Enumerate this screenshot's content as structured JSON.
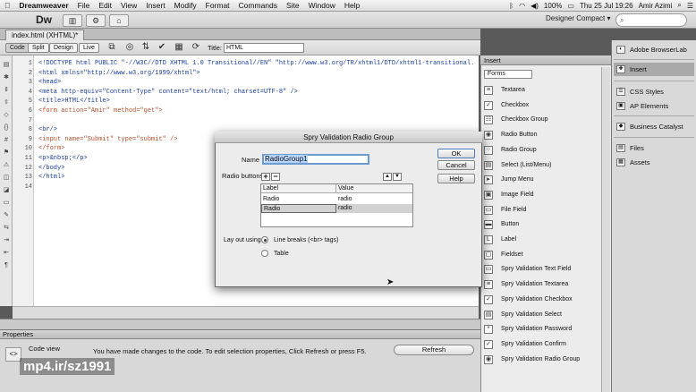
{
  "menubar": {
    "apple": "",
    "app_name": "Dreamweaver",
    "items": [
      "File",
      "Edit",
      "View",
      "Insert",
      "Modify",
      "Format",
      "Commands",
      "Site",
      "Window",
      "Help"
    ],
    "battery": "100%",
    "clock": "Thu 25 Jul 19:26",
    "user": "Amir Azimi"
  },
  "appbar": {
    "logo": "Dw",
    "workspace": "Designer Compact ▾"
  },
  "document": {
    "tab": "index.html (XHTML)*"
  },
  "toolbar": {
    "code": "Code",
    "split": "Split",
    "design": "Design",
    "live": "Live",
    "title_label": "Title:",
    "title_value": "HTML"
  },
  "code": {
    "line_numbers": [
      "1",
      "2",
      "3",
      "4",
      "5",
      "6",
      "7",
      "8",
      "9",
      "10",
      "11",
      "12",
      "13",
      "14"
    ],
    "lines": [
      "<!DOCTYPE html PUBLIC \"-//W3C//DTD XHTML 1.0 Transitional//EN\" \"http://www.w3.org/TR/xhtml1/DTD/xhtml1-transitional.",
      "<html xmlns=\"http://www.w3.org/1999/xhtml\">",
      "<head>",
      "<meta http-equiv=\"Content-Type\" content=\"text/html; charset=UTF-8\" />",
      "<title>HTML</title>",
      "<form action=\"Amir\" method=\"get\">",
      "",
      "<br/>",
      "<input name=\"Submit\" type=\"submit\" />",
      "</form>",
      "<p>&nbsp;</p>",
      "</body>",
      "</html>",
      ""
    ]
  },
  "properties": {
    "title": "Properties",
    "code_view": "Code view",
    "message": "You have made changes to the code. To edit selection properties, Click Refresh or press F5.",
    "refresh": "Refresh"
  },
  "watermark": "mp4.ir/sz1991",
  "insert_panel": {
    "title": "Insert",
    "category": "Forms",
    "items": [
      {
        "label": "Textarea",
        "icon": "textarea-icon",
        "glyph": "≡"
      },
      {
        "label": "Checkbox",
        "icon": "checkbox-icon",
        "glyph": "✓"
      },
      {
        "label": "Checkbox Group",
        "icon": "checkbox-group-icon",
        "glyph": "☷"
      },
      {
        "label": "Radio Button",
        "icon": "radio-button-icon",
        "glyph": "◉"
      },
      {
        "label": "Radio Group",
        "icon": "radio-group-icon",
        "glyph": "⁘"
      },
      {
        "label": "Select (List/Menu)",
        "icon": "select-icon",
        "glyph": "▤"
      },
      {
        "label": "Jump Menu",
        "icon": "jump-menu-icon",
        "glyph": "▸"
      },
      {
        "label": "Image Field",
        "icon": "image-field-icon",
        "glyph": "▣"
      },
      {
        "label": "File Field",
        "icon": "file-field-icon",
        "glyph": "▭"
      },
      {
        "label": "Button",
        "icon": "button-icon",
        "glyph": "▬"
      },
      {
        "label": "Label",
        "icon": "label-icon",
        "glyph": "L"
      },
      {
        "label": "Fieldset",
        "icon": "fieldset-icon",
        "glyph": "▢"
      },
      {
        "label": "Spry Validation Text Field",
        "icon": "spry-text-field-icon",
        "glyph": "▭"
      },
      {
        "label": "Spry Validation Textarea",
        "icon": "spry-textarea-icon",
        "glyph": "≡"
      },
      {
        "label": "Spry Validation Checkbox",
        "icon": "spry-checkbox-icon",
        "glyph": "✓"
      },
      {
        "label": "Spry Validation Select",
        "icon": "spry-select-icon",
        "glyph": "▤"
      },
      {
        "label": "Spry Validation Password",
        "icon": "spry-password-icon",
        "glyph": "*"
      },
      {
        "label": "Spry Validation Confirm",
        "icon": "spry-confirm-icon",
        "glyph": "✓"
      },
      {
        "label": "Spry Validation Radio Group",
        "icon": "spry-radio-group-icon",
        "glyph": "◉"
      }
    ]
  },
  "right_panel": {
    "items": [
      {
        "label": "Adobe BrowserLab",
        "icon": "browserlab-icon",
        "glyph": "◐"
      },
      {
        "label": "Insert",
        "icon": "insert-icon",
        "glyph": "✚"
      },
      {
        "label": "CSS Styles",
        "icon": "css-styles-icon",
        "glyph": "☰"
      },
      {
        "label": "AP Elements",
        "icon": "ap-elements-icon",
        "glyph": "▣"
      },
      {
        "label": "Business Catalyst",
        "icon": "business-catalyst-icon",
        "glyph": "◆"
      },
      {
        "label": "Files",
        "icon": "files-icon",
        "glyph": "▤"
      },
      {
        "label": "Assets",
        "icon": "assets-icon",
        "glyph": "▦"
      }
    ]
  },
  "dialog": {
    "title": "Spry Validation Radio Group",
    "name_label": "Name",
    "name_value": "RadioGroup1",
    "radio_buttons_label": "Radio buttons",
    "columns": [
      "Label",
      "Value"
    ],
    "rows": [
      {
        "label": "Radio",
        "value": "radio"
      },
      {
        "label": "Radio",
        "value": "radio"
      }
    ],
    "layout_label": "Lay out using:",
    "layout_option_1": "Line breaks (<br> tags)",
    "layout_option_2": "Table",
    "ok": "OK",
    "cancel": "Cancel",
    "help": "Help"
  }
}
